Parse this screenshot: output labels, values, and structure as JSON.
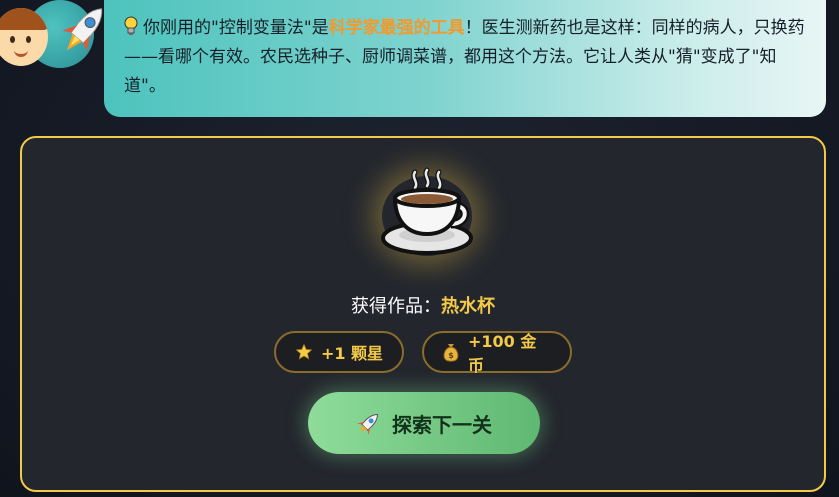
{
  "message": {
    "part1": "你刚用的\"控制变量法\"是",
    "highlight": "科学家最强的工具",
    "part2": "！医生测新药也是这样：同样的病人，只换药——看哪个有效。农民选种子、厨师调菜谱，都用这个方法。它让人类从\"猜\"变成了\"知道\"。",
    "icon": "lightbulb-icon"
  },
  "avatars": [
    "boy-avatar",
    "rocket-avatar"
  ],
  "reward": {
    "item_icon": "hot-cup-icon",
    "label": "获得作品：",
    "item_name": "热水杯",
    "star_reward": "+1 颗星",
    "coin_reward": "+100 金币"
  },
  "next_button": {
    "label": "探索下一关",
    "icon": "rocket-icon"
  },
  "colors": {
    "accent_gold": "#f3c947",
    "highlight_orange": "#f29a2e",
    "button_green": "#6cc57e",
    "bubble_teal": "#4dc3bd"
  }
}
